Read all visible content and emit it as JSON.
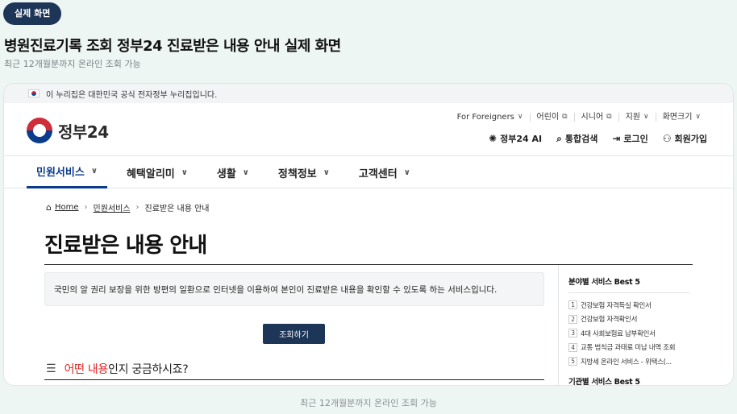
{
  "badge": "실제 화면",
  "headline": "병원진료기록 조회 정부24 진료받은 내용 안내 실제 화면",
  "subhead": "최근 12개월분까지 온라인 조회 가능",
  "caption": "최근 12개월분까지 온라인 조회 가능",
  "site": {
    "gov_notice": "이 누리집은 대한민국 공식 전자정부 누리집입니다.",
    "logo_text": "정부24",
    "utility": [
      {
        "label": "For Foreigners",
        "icon": "chevron-down-icon",
        "glyph": "∨"
      },
      {
        "label": "어린이",
        "icon": "external-link-icon",
        "glyph": "⧉"
      },
      {
        "label": "시니어",
        "icon": "external-link-icon",
        "glyph": "⧉"
      },
      {
        "label": "지원",
        "icon": "chevron-down-icon",
        "glyph": "∨"
      },
      {
        "label": "화면크기",
        "icon": "chevron-down-icon",
        "glyph": "∨"
      }
    ],
    "actions": [
      {
        "label": "정부24 AI",
        "icon": "ai-icon",
        "glyph": "✺"
      },
      {
        "label": "통합검색",
        "icon": "search-icon",
        "glyph": "⌕"
      },
      {
        "label": "로그인",
        "icon": "login-icon",
        "glyph": "⇥"
      },
      {
        "label": "회원가입",
        "icon": "user-plus-icon",
        "glyph": "⚇"
      }
    ],
    "gnb": [
      "민원서비스",
      "혜택알리미",
      "생활",
      "정책정보",
      "고객센터"
    ],
    "breadcrumb": {
      "home": "Home",
      "level1": "민원서비스",
      "current": "진료받은 내용 안내"
    },
    "page_title": "진료받은 내용 안내",
    "description": "국민의 알 권리 보장을 위한 방편의 일환으로 인터넷을 이용하여 본인이 진료받은 내용을 확인할 수 있도록 하는 서비스입니다.",
    "query_button": "조회하기",
    "question": {
      "highlight": "어떤 내용",
      "rest": "인지 궁금하시죠?"
    },
    "sidebar": {
      "best_title": "분야별 서비스 Best 5",
      "best_items": [
        "건강보험 자격득실 확인서",
        "건강보험 자격확인서",
        "4대 사회보험료 납부확인서",
        "교통 범칙금 과태료 미납 내역 조회",
        "지방세 온라인 서비스 - 위택스(..."
      ],
      "org_title": "기관별 서비스 Best 5"
    }
  },
  "colors": {
    "accent": "#1d3557",
    "brand_blue": "#0b3b8c",
    "highlight_red": "#dd2222"
  }
}
